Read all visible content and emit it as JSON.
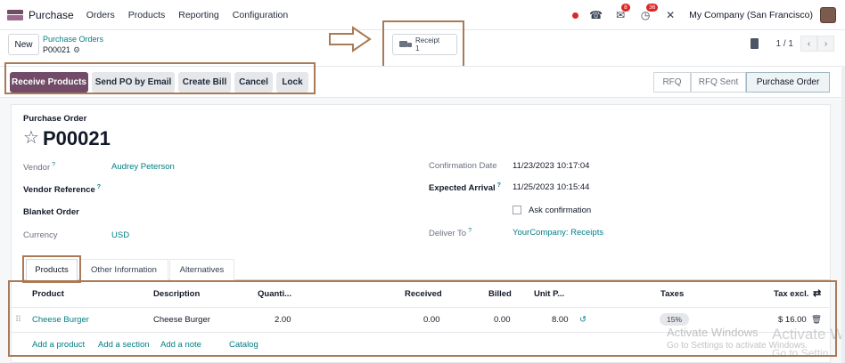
{
  "navbar": {
    "app_name": "Purchase",
    "menus": [
      "Orders",
      "Products",
      "Reporting",
      "Configuration"
    ],
    "chat_badge": "8",
    "activity_badge": "36",
    "company": "My Company (San Francisco)"
  },
  "control": {
    "new_label": "New",
    "breadcrumb_parent": "Purchase Orders",
    "breadcrumb_current": "P00021",
    "smart_button": {
      "label": "Receipt",
      "count": "1"
    },
    "pager": "1 / 1"
  },
  "actions": [
    "Receive Products",
    "Send PO by Email",
    "Create Bill",
    "Cancel",
    "Lock"
  ],
  "stages": [
    "RFQ",
    "RFQ Sent",
    "Purchase Order"
  ],
  "form": {
    "subtitle": "Purchase Order",
    "title": "P00021",
    "vendor_label": "Vendor",
    "vendor": "Audrey Peterson",
    "vendor_ref_label": "Vendor Reference",
    "blanket_label": "Blanket Order",
    "currency_label": "Currency",
    "currency": "USD",
    "confirmation_label": "Confirmation Date",
    "confirmation": "11/23/2023 10:17:04",
    "expected_label": "Expected Arrival",
    "expected": "11/25/2023 10:15:44",
    "ask_confirmation": "Ask confirmation",
    "deliver_label": "Deliver To",
    "deliver": "YourCompany: Receipts",
    "help_mark": "?"
  },
  "tabs": [
    "Products",
    "Other Information",
    "Alternatives"
  ],
  "table": {
    "headers": [
      "Product",
      "Description",
      "Quanti...",
      "Received",
      "Billed",
      "Unit P...",
      "Taxes",
      "Tax excl."
    ],
    "row": {
      "product": "Cheese Burger",
      "description": "Cheese Burger",
      "quantity": "2.00",
      "received": "0.00",
      "billed": "0.00",
      "unit_price": "8.00",
      "tax": "15%",
      "total": "$ 16.00"
    },
    "add_links": [
      "Add a product",
      "Add a section",
      "Add a note",
      "Catalog"
    ]
  },
  "watermark": {
    "line1": "Activate Windows",
    "line2": "Go to Settings to activate Windows.",
    "big1": "Activate W",
    "big2": "Go to Settin"
  },
  "colors": {
    "brand": "#714B67",
    "link": "#017e84",
    "annotation": "#a97a55"
  }
}
